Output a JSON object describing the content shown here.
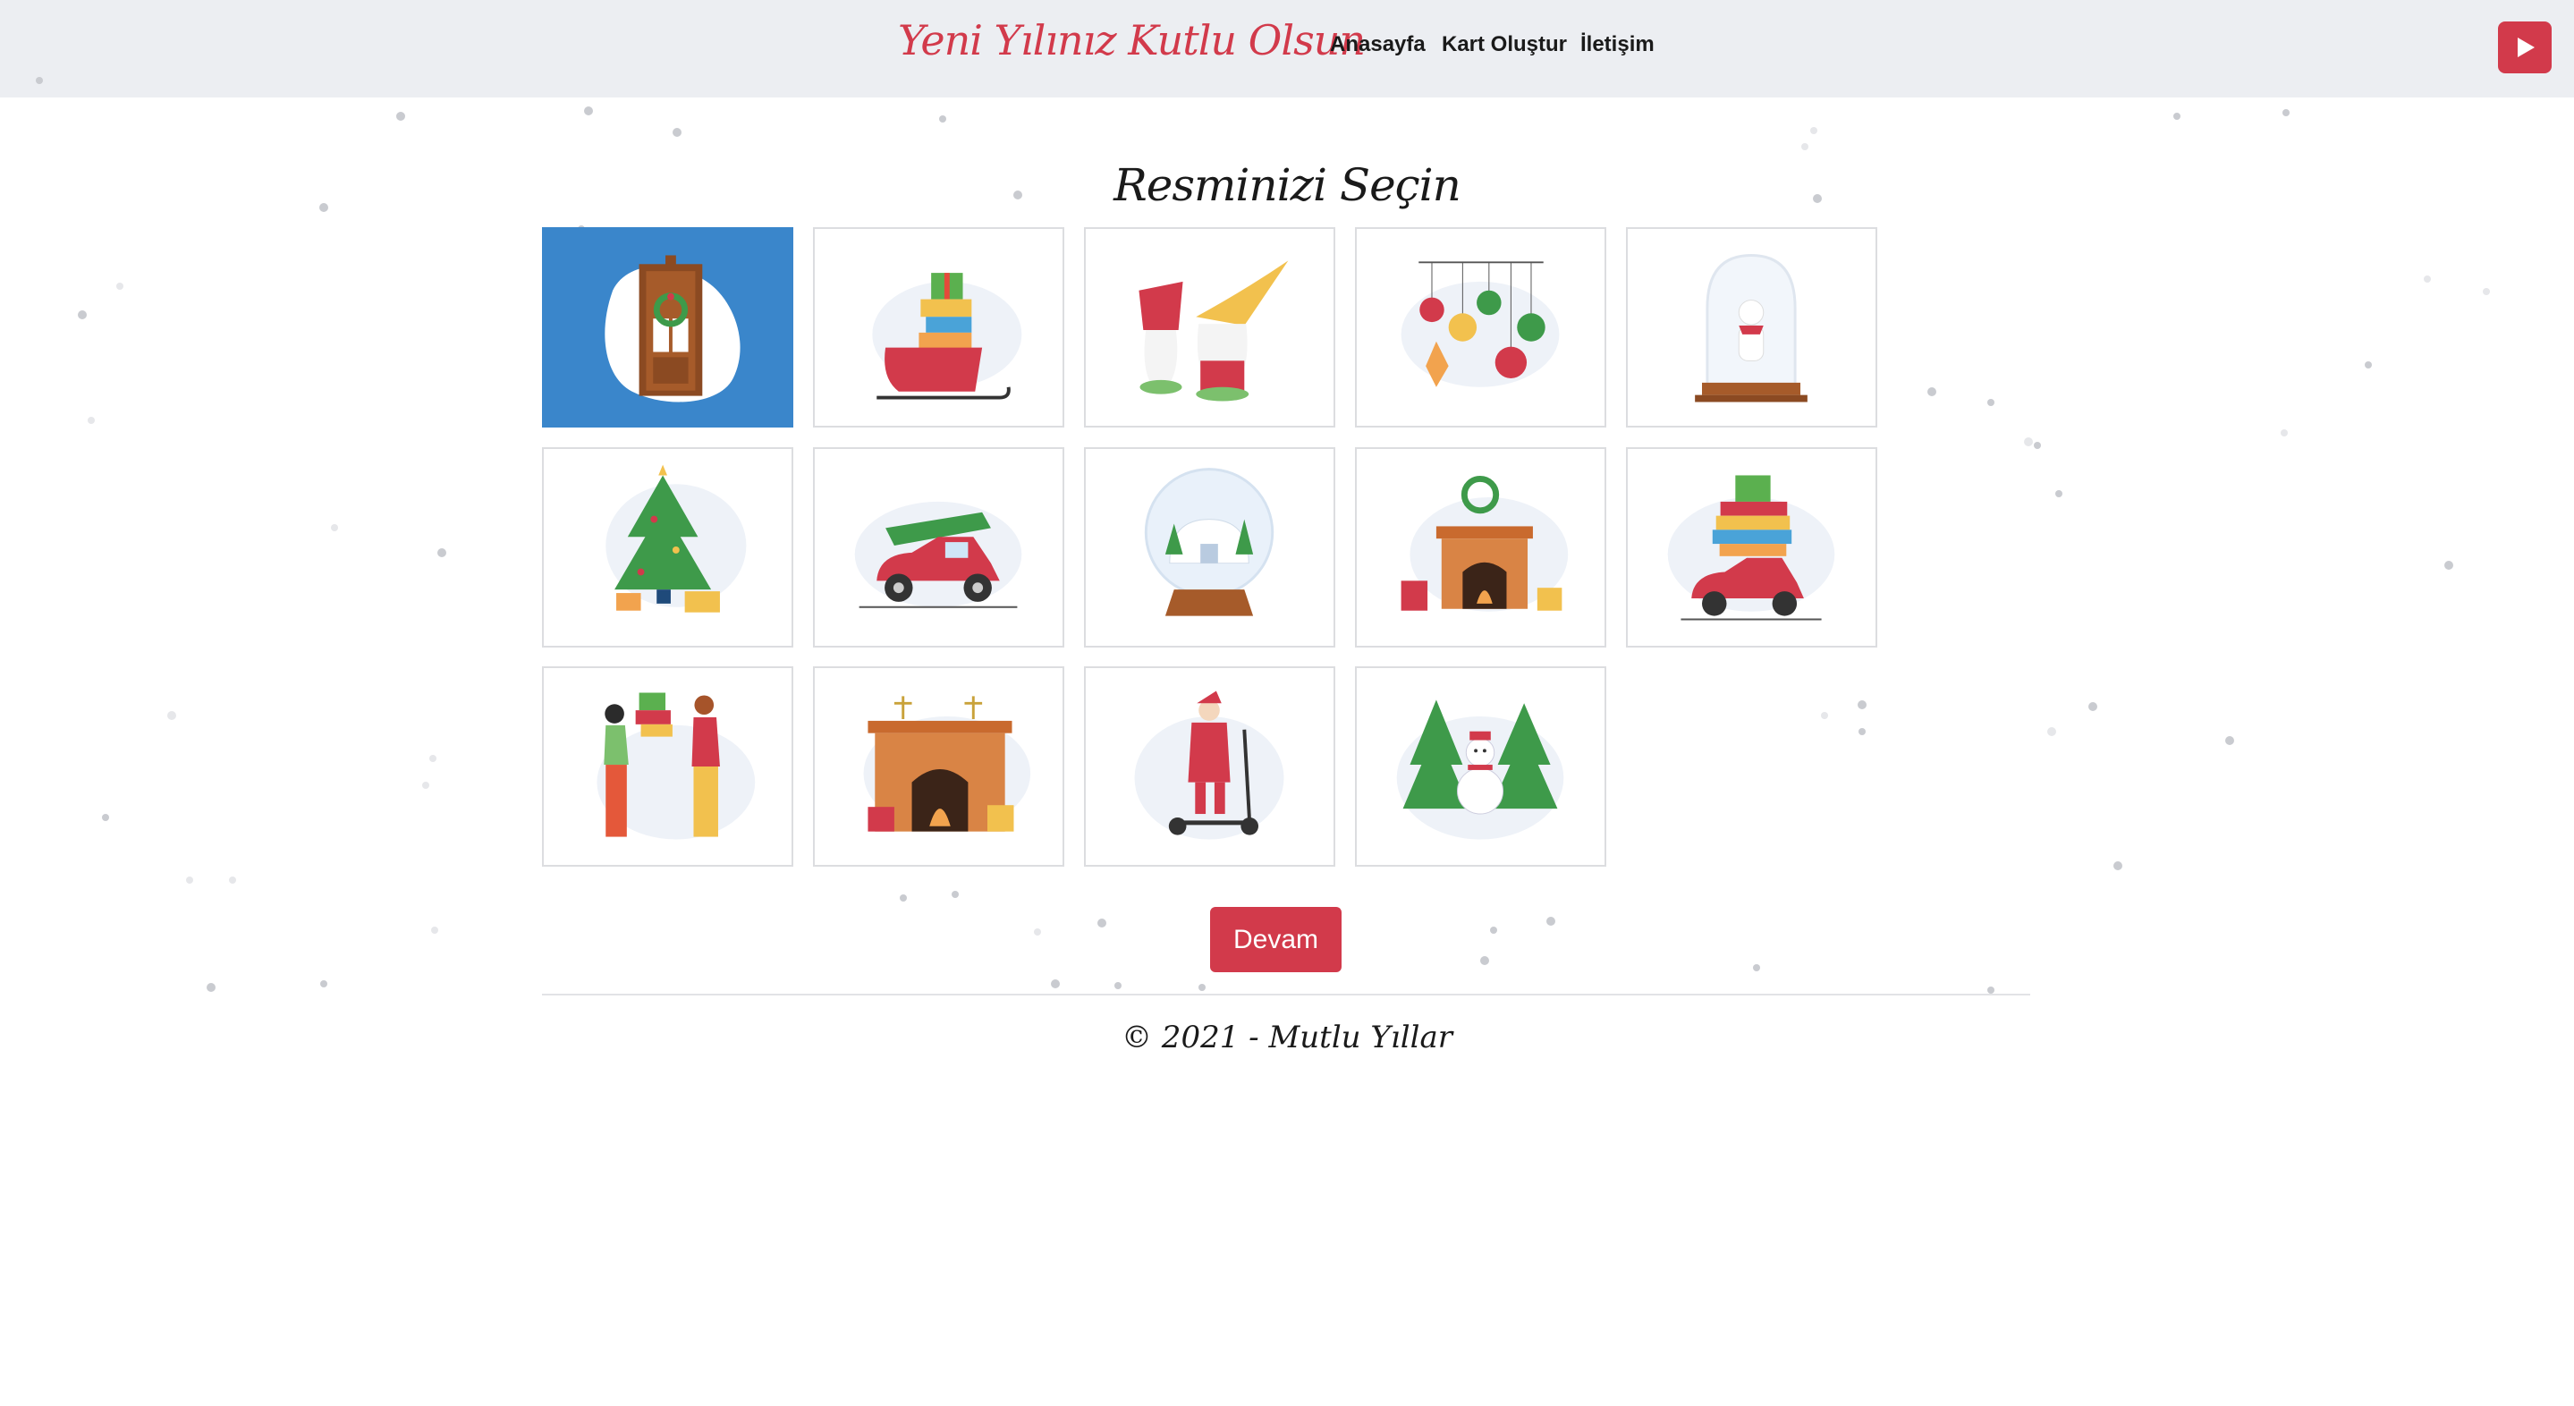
{
  "header": {
    "brand": "Yeni Yılınız Kutlu Olsun",
    "nav": [
      "Anasayfa",
      "Kart Oluştur",
      "İletişim"
    ],
    "play_icon": "play-icon"
  },
  "main": {
    "heading": "Resminizi Seçin",
    "selected_index": 0,
    "images": [
      "door-wreath",
      "sleigh-gifts",
      "gnomes",
      "ornaments",
      "snow-globe-bear",
      "christmas-tree",
      "car-with-tree",
      "igloo-snow-globe",
      "fireplace-wreath",
      "car-with-gifts",
      "people-exchanging-gifts",
      "fireplace-candles",
      "santa-scooter",
      "snowman-trees"
    ],
    "continue_label": "Devam"
  },
  "footer": {
    "text": "© 2021 - Mutlu Yıllar"
  },
  "colors": {
    "accent": "#d23a4b",
    "selected": "#3a86cb",
    "navbar": "#eceef2"
  }
}
